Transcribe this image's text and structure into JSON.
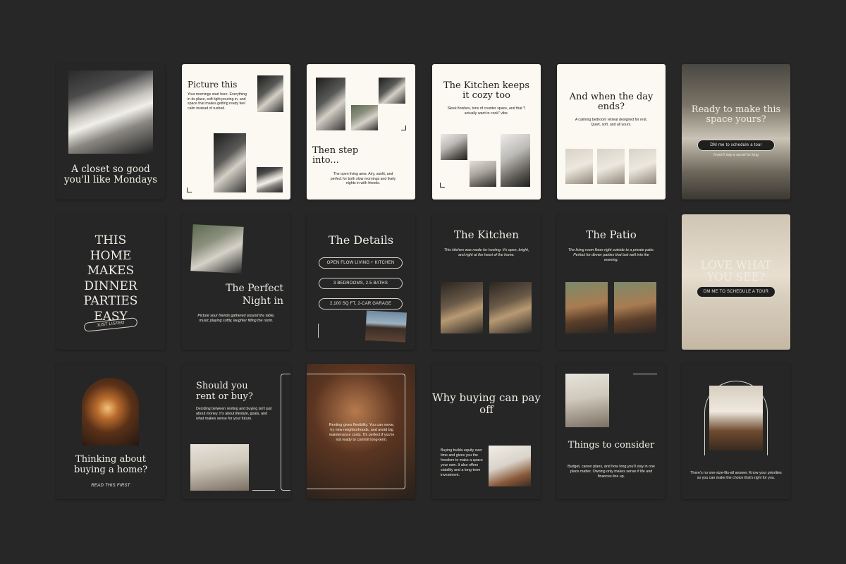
{
  "row1": {
    "c1": {
      "title": "A closet so good you'll like Mondays"
    },
    "c2": {
      "title": "Picture this",
      "body": "Your mornings start here. Everything in its place, soft light pouring in, and space that makes getting ready feel calm instead of rushed."
    },
    "c3": {
      "title": "Then step into...",
      "body": "The open living area. Airy, sunlit, and perfect for both slow mornings and lively nights in with friends."
    },
    "c4": {
      "title": "The Kitchen keeps it cozy too",
      "body": "Sleek finishes, tons of counter space, and that \"I actually want to cook\" vibe."
    },
    "c5": {
      "title": "And when the day ends?",
      "body": "A calming bedroom retreat designed for rest. Quiet, soft, and all yours."
    },
    "c6": {
      "title": "Ready to make this space yours?",
      "button": "DM me to schedule a tour",
      "small": "It won't stay a secret for long"
    }
  },
  "row2": {
    "c1": {
      "lines": [
        "THIS",
        "HOME",
        "MAKES",
        "DINNER",
        "PARTIES",
        "EASY"
      ],
      "badge": "JUST LISTED"
    },
    "c2": {
      "title": "The Perfect Night in",
      "body": "Picture your friends gathered around the table, music playing softly, laughter filling the room."
    },
    "c3": {
      "title": "The Details",
      "pills": [
        "OPEN FLOW LIVING + KITCHEN",
        "3 BEDROOMS, 2.5 BATHS",
        "2,100 SQ FT, 2-CAR GARAGE"
      ]
    },
    "c4": {
      "title": "The Kitchen",
      "body": "This kitchen was made for hosting. It's open, bright, and right at the heart of the home."
    },
    "c5": {
      "title": "The Patio",
      "body": "The living room flows right outside to a private patio. Perfect for dinner parties that last well into the evening."
    },
    "c6": {
      "title": "LOVE WHAT YOU SEE?",
      "button": "DM ME TO SCHEDULE A TOUR"
    }
  },
  "row3": {
    "c1": {
      "title": "Thinking about buying a home?",
      "small": "READ THIS FIRST"
    },
    "c2": {
      "title": "Should you rent or buy?",
      "body": "Deciding between renting and buying isn't just about money. It's about lifestyle, goals, and what makes sense for your future."
    },
    "c3": {
      "body": "Renting gives flexibility. You can move, try new neighborhoods, and avoid big maintenance costs. It's perfect if you're not ready to commit long-term."
    },
    "c4": {
      "title": "Why buying can pay off",
      "body": "Buying builds equity over time and gives you the freedom to make a space your own. It also offers stability and a long-term investment."
    },
    "c5": {
      "title": "Things to consider",
      "body": "Budget, career plans, and how long you'll stay in one place matter. Owning only makes sense if life and finances line up."
    },
    "c6": {
      "body": "There's no one-size-fits-all answer. Know your priorities so you can make the choice that's right for you."
    }
  }
}
